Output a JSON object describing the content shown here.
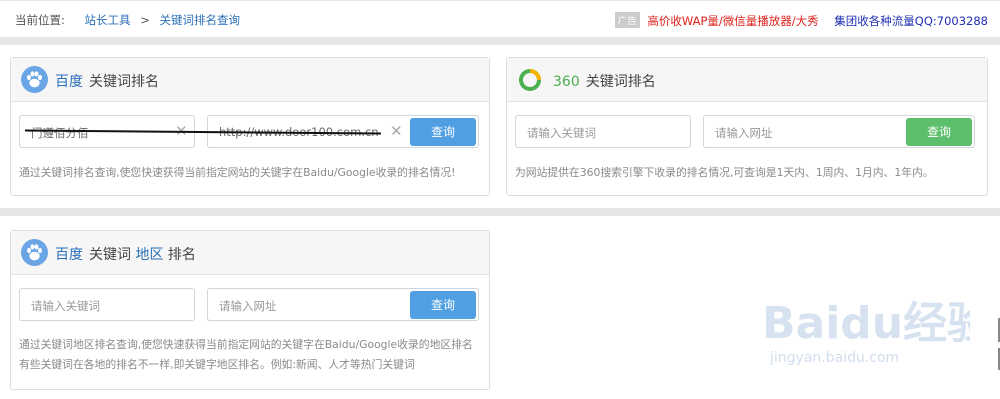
{
  "breadcrumb": {
    "prefix": "当前位置:",
    "link1": "站长工具",
    "sep": ">",
    "link2": "关键词排名查询"
  },
  "ad": {
    "badge": "广告",
    "link": "高价收WAP量/微信量播放器/大秀",
    "qq": "集团收各种流量QQ:7003288"
  },
  "baidu_card": {
    "brand": "百度",
    "title": "关键词排名",
    "keyword_value": "门遵佰分佰",
    "url_value": "http://www.door100.com.cn",
    "query_label": "查询",
    "desc": "通过关键词排名查询,使您快速获得当前指定网站的关键字在Baidu/Google收录的排名情况!"
  },
  "so360_card": {
    "brand": "360",
    "title": "关键词排名",
    "keyword_placeholder": "请输入关键词",
    "url_placeholder": "请输入网址",
    "query_label": "查询",
    "desc": "为网站提供在360搜索引擎下收录的排名情况,可查询是1天内、1周内、1月内、1年内。"
  },
  "region_card": {
    "brand": "百度",
    "title_a": "关键词",
    "title_region": "地区",
    "title_b": "排名",
    "keyword_placeholder": "请输入关键词",
    "url_placeholder": "请输入网址",
    "query_label": "查询",
    "desc1": "通过关键词地区排名查询,使您快速获得当前指定网站的关键字在Baidu/Google收录的地区排名",
    "desc2": "有些关键词在各地的排名不一样,即关键字地区排名。例如:新闻、人才等热门关键词"
  },
  "watermark": {
    "text": "Baidu经验",
    "sub": "jingyan.baidu.com"
  },
  "colors": {
    "link": "#2a6fb8",
    "ad_red": "#e0211a",
    "qq_blue": "#1f2fb3",
    "button_blue": "#4f9fe2",
    "button_green": "#5cbf6b"
  },
  "icons": [
    "paw-icon",
    "ring-360-icon",
    "clear-x-icon"
  ]
}
